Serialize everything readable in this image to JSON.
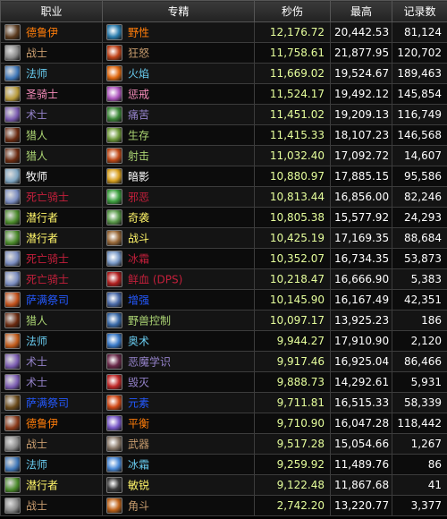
{
  "headers": {
    "class": "职业",
    "spec": "专精",
    "dps": "秒伤",
    "max": "最高",
    "count": "记录数"
  },
  "rows": [
    {
      "cls": "德鲁伊",
      "clsColor": "#ff7d0a",
      "spec": "野性",
      "specColor": "#ff7d0a",
      "dps": "12,176.72",
      "max": "20,442.53",
      "count": "81,124",
      "ci": "#5b3a1e",
      "si": "#2d7fb0"
    },
    {
      "cls": "战士",
      "clsColor": "#c79c6e",
      "spec": "狂怒",
      "specColor": "#c79c6e",
      "dps": "11,758.61",
      "max": "21,877.95",
      "count": "120,702",
      "ci": "#8a8a8a",
      "si": "#c0441a"
    },
    {
      "cls": "法师",
      "clsColor": "#69ccf0",
      "spec": "火焰",
      "specColor": "#69ccf0",
      "dps": "11,669.02",
      "max": "19,524.67",
      "count": "189,463",
      "ci": "#3f77b8",
      "si": "#e06a12"
    },
    {
      "cls": "圣骑士",
      "clsColor": "#f58cba",
      "spec": "惩戒",
      "specColor": "#f58cba",
      "dps": "11,524.17",
      "max": "19,492.12",
      "count": "145,854",
      "ci": "#b89a3a",
      "si": "#b058c0"
    },
    {
      "cls": "术士",
      "clsColor": "#9482c9",
      "spec": "痛苦",
      "specColor": "#9482c9",
      "dps": "11,451.02",
      "max": "19,209.13",
      "count": "116,749",
      "ci": "#7a5bb0",
      "si": "#3e8a3a"
    },
    {
      "cls": "猎人",
      "clsColor": "#abd473",
      "spec": "生存",
      "specColor": "#abd473",
      "dps": "11,415.33",
      "max": "18,107.23",
      "count": "146,568",
      "ci": "#6a2a10",
      "si": "#6f9a3a"
    },
    {
      "cls": "猎人",
      "clsColor": "#abd473",
      "spec": "射击",
      "specColor": "#abd473",
      "dps": "11,032.40",
      "max": "17,092.72",
      "count": "14,607",
      "ci": "#6a2a10",
      "si": "#c04a18"
    },
    {
      "cls": "牧师",
      "clsColor": "#ffffff",
      "spec": "暗影",
      "specColor": "#ffffff",
      "dps": "10,880.97",
      "max": "17,885.15",
      "count": "95,586",
      "ci": "#7ea4c0",
      "si": "#d8a020"
    },
    {
      "cls": "死亡骑士",
      "clsColor": "#c41f3b",
      "spec": "邪恶",
      "specColor": "#c41f3b",
      "dps": "10,813.44",
      "max": "16,856.00",
      "count": "82,246",
      "ci": "#7a8cc0",
      "si": "#3ea040"
    },
    {
      "cls": "潜行者",
      "clsColor": "#fff569",
      "spec": "奇袭",
      "specColor": "#fff569",
      "dps": "10,805.38",
      "max": "15,577.92",
      "count": "24,293",
      "ci": "#4a8a2a",
      "si": "#5a9a4a"
    },
    {
      "cls": "潜行者",
      "clsColor": "#fff569",
      "spec": "战斗",
      "specColor": "#fff569",
      "dps": "10,425.19",
      "max": "17,169.35",
      "count": "88,684",
      "ci": "#4a8a2a",
      "si": "#9a6a3a"
    },
    {
      "cls": "死亡骑士",
      "clsColor": "#c41f3b",
      "spec": "冰霜",
      "specColor": "#c41f3b",
      "dps": "10,352.07",
      "max": "16,734.35",
      "count": "53,873",
      "ci": "#7a8cc0",
      "si": "#7a9ac8"
    },
    {
      "cls": "死亡骑士",
      "clsColor": "#c41f3b",
      "spec": "鲜血 (DPS)",
      "specColor": "#c41f3b",
      "dps": "10,218.47",
      "max": "16,666.90",
      "count": "5,383",
      "ci": "#7a8cc0",
      "si": "#b02020"
    },
    {
      "cls": "萨满祭司",
      "clsColor": "#2459ff",
      "spec": "增强",
      "specColor": "#2459ff",
      "dps": "10,145.90",
      "max": "16,167.49",
      "count": "42,351",
      "ci": "#c0501a",
      "si": "#4a6aa8"
    },
    {
      "cls": "猎人",
      "clsColor": "#abd473",
      "spec": "野兽控制",
      "specColor": "#abd473",
      "dps": "10,097.17",
      "max": "13,925.23",
      "count": "186",
      "ci": "#6a2a10",
      "si": "#3a6aa8"
    },
    {
      "cls": "法师",
      "clsColor": "#69ccf0",
      "spec": "奥术",
      "specColor": "#69ccf0",
      "dps": "9,944.27",
      "max": "17,910.90",
      "count": "2,120",
      "ci": "#c05a1a",
      "si": "#3a7ac8"
    },
    {
      "cls": "术士",
      "clsColor": "#9482c9",
      "spec": "恶魔学识",
      "specColor": "#9482c9",
      "dps": "9,917.46",
      "max": "16,925.04",
      "count": "86,466",
      "ci": "#7a5bb0",
      "si": "#6a2a4a"
    },
    {
      "cls": "术士",
      "clsColor": "#9482c9",
      "spec": "毁灭",
      "specColor": "#9482c9",
      "dps": "9,888.73",
      "max": "14,292.61",
      "count": "5,931",
      "ci": "#7a5bb0",
      "si": "#c02a2a"
    },
    {
      "cls": "萨满祭司",
      "clsColor": "#2459ff",
      "spec": "元素",
      "specColor": "#2459ff",
      "dps": "9,711.81",
      "max": "16,515.33",
      "count": "58,339",
      "ci": "#6a4a1a",
      "si": "#d04a18"
    },
    {
      "cls": "德鲁伊",
      "clsColor": "#ff7d0a",
      "spec": "平衡",
      "specColor": "#ff7d0a",
      "dps": "9,710.90",
      "max": "16,047.28",
      "count": "118,442",
      "ci": "#8a3a1a",
      "si": "#7a5ac8"
    },
    {
      "cls": "战士",
      "clsColor": "#c79c6e",
      "spec": "武器",
      "specColor": "#c79c6e",
      "dps": "9,517.28",
      "max": "15,054.66",
      "count": "1,267",
      "ci": "#8a8a8a",
      "si": "#8a7a6a"
    },
    {
      "cls": "法师",
      "clsColor": "#69ccf0",
      "spec": "冰霜",
      "specColor": "#69ccf0",
      "dps": "9,259.92",
      "max": "11,489.76",
      "count": "86",
      "ci": "#3f77b8",
      "si": "#4a8ad8"
    },
    {
      "cls": "潜行者",
      "clsColor": "#fff569",
      "spec": "敏锐",
      "specColor": "#fff569",
      "dps": "9,122.48",
      "max": "11,867.68",
      "count": "41",
      "ci": "#4a8a2a",
      "si": "#3a3a3a"
    },
    {
      "cls": "战士",
      "clsColor": "#c79c6e",
      "spec": "角斗",
      "specColor": "#c79c6e",
      "dps": "2,742.20",
      "max": "13,220.77",
      "count": "3,377",
      "ci": "#8a8a8a",
      "si": "#c0641a"
    }
  ]
}
